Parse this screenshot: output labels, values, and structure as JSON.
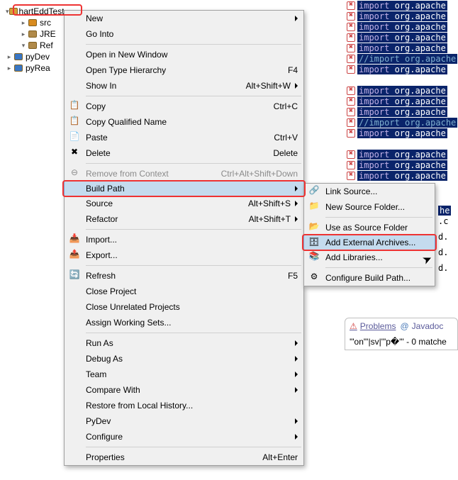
{
  "tree": {
    "items": [
      {
        "label": "hartEddTest",
        "twisty": "▾",
        "highlight": true
      },
      {
        "label": "src",
        "twisty": "▸",
        "indent": 1,
        "iconColor": "#d88b1f"
      },
      {
        "label": "JRE",
        "twisty": "▸",
        "indent": 1,
        "iconColor": "#b08a4a"
      },
      {
        "label": "Ref",
        "twisty": "▾",
        "indent": 1,
        "iconColor": "#b08a4a"
      },
      {
        "label": "pyDev",
        "twisty": "▸",
        "indent": 0,
        "iconColor": "#3a77c4"
      },
      {
        "label": "pyRea",
        "twisty": "▸",
        "indent": 0,
        "iconColor": "#3a77c4"
      }
    ]
  },
  "menu": {
    "items": [
      {
        "label": "New",
        "submenu": true,
        "icon": ""
      },
      {
        "label": "Go Into"
      },
      {
        "sep": true
      },
      {
        "label": "Open in New Window"
      },
      {
        "label": "Open Type Hierarchy",
        "accel": "F4"
      },
      {
        "label": "Show In",
        "accel": "Alt+Shift+W",
        "submenu": true
      },
      {
        "sep": true
      },
      {
        "label": "Copy",
        "accel": "Ctrl+C",
        "icon": "copy"
      },
      {
        "label": "Copy Qualified Name",
        "icon": "copy"
      },
      {
        "label": "Paste",
        "accel": "Ctrl+V",
        "icon": "paste"
      },
      {
        "label": "Delete",
        "accel": "Delete",
        "icon": "delete"
      },
      {
        "sep": true
      },
      {
        "label": "Remove from Context",
        "accel": "Ctrl+Alt+Shift+Down",
        "icon": "remove",
        "disabled": true
      },
      {
        "label": "Build Path",
        "submenu": true,
        "hovered": true,
        "highlight": true
      },
      {
        "label": "Source",
        "accel": "Alt+Shift+S",
        "submenu": true
      },
      {
        "label": "Refactor",
        "accel": "Alt+Shift+T",
        "submenu": true
      },
      {
        "sep": true
      },
      {
        "label": "Import...",
        "icon": "import"
      },
      {
        "label": "Export...",
        "icon": "export"
      },
      {
        "sep": true
      },
      {
        "label": "Refresh",
        "accel": "F5",
        "icon": "refresh"
      },
      {
        "label": "Close Project"
      },
      {
        "label": "Close Unrelated Projects"
      },
      {
        "label": "Assign Working Sets..."
      },
      {
        "sep": true
      },
      {
        "label": "Run As",
        "submenu": true
      },
      {
        "label": "Debug As",
        "submenu": true
      },
      {
        "label": "Team",
        "submenu": true
      },
      {
        "label": "Compare With",
        "submenu": true
      },
      {
        "label": "Restore from Local History..."
      },
      {
        "label": "PyDev",
        "submenu": true
      },
      {
        "label": "Configure",
        "submenu": true
      },
      {
        "sep": true
      },
      {
        "label": "Properties",
        "accel": "Alt+Enter"
      }
    ]
  },
  "submenu": {
    "items": [
      {
        "label": "Link Source...",
        "icon": "link"
      },
      {
        "label": "New Source Folder...",
        "icon": "folder"
      },
      {
        "sep": true
      },
      {
        "label": "Use as Source Folder",
        "icon": "srcfolder"
      },
      {
        "label": "Add External Archives...",
        "icon": "jar",
        "hovered": true,
        "highlight": true
      },
      {
        "label": "Add Libraries...",
        "icon": "books"
      },
      {
        "sep": true
      },
      {
        "label": "Configure Build Path...",
        "icon": "config"
      }
    ]
  },
  "editor": {
    "lines": [
      {
        "kind": "import",
        "text": "import org.apache"
      },
      {
        "kind": "import",
        "text": "import org.apache"
      },
      {
        "kind": "import",
        "text": "import org.apache"
      },
      {
        "kind": "import",
        "text": "import org.apache"
      },
      {
        "kind": "import",
        "text": "import org.apache"
      },
      {
        "kind": "comment",
        "text": "//import org.apache"
      },
      {
        "kind": "import",
        "text": "import org.apache"
      },
      {
        "blank": true
      },
      {
        "kind": "import",
        "text": "import org.apache"
      },
      {
        "kind": "import",
        "text": "import org.apache"
      },
      {
        "kind": "import",
        "text": "import org.apache"
      },
      {
        "kind": "comment",
        "text": "//import org.apache"
      },
      {
        "kind": "import",
        "text": "import org.apache"
      },
      {
        "blank": true
      },
      {
        "kind": "import",
        "text": "import org.apache"
      },
      {
        "kind": "import",
        "text": "import org.apache"
      },
      {
        "kind": "import",
        "text": "import org.apache"
      }
    ]
  },
  "editor_trailer": {
    "lines": [
      "he",
      ".c",
      "d.",
      "d.",
      "d."
    ]
  },
  "problems": {
    "tab1": "Problems",
    "tab2": "Javadoc",
    "info": "'\"on\"'|sv|'\"p�\"' - 0 matche"
  },
  "icons": {
    "copy": "📋",
    "paste": "📄",
    "delete": "✖",
    "remove": "⊖",
    "import": "📥",
    "export": "📤",
    "refresh": "🔄",
    "link": "🔗",
    "folder": "📁",
    "srcfolder": "📂",
    "jar": "🗄",
    "books": "📚",
    "config": "⚙",
    "error": "⮾"
  }
}
